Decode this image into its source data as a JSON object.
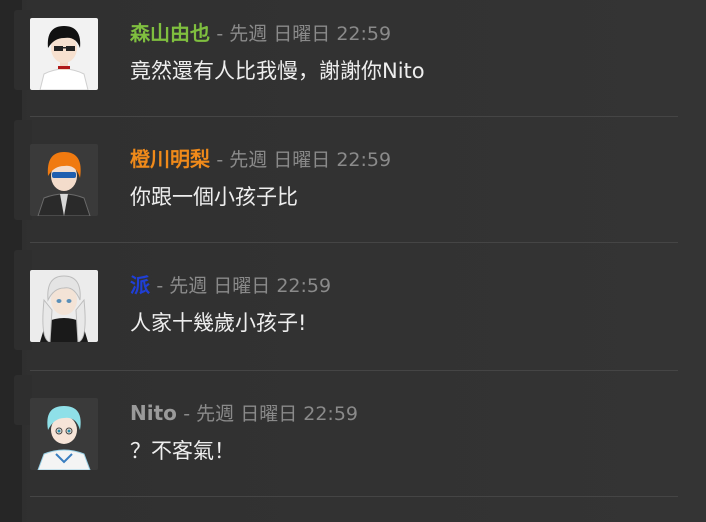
{
  "messages": [
    {
      "author": "森山由也",
      "author_color": "#7fbf3f",
      "timestamp": "- 先週 日曜日 22:59",
      "text": "竟然還有人比我慢，謝謝你Nito"
    },
    {
      "author": "橙川明梨",
      "author_color": "#f08a1a",
      "timestamp": "- 先週 日曜日 22:59",
      "text": "你跟一個小孩子比"
    },
    {
      "author": "派",
      "author_color": "#1f3fd6",
      "timestamp": "- 先週 日曜日 22:59",
      "text": "人家十幾歲小孩子!"
    },
    {
      "author": "Nito",
      "author_color": "#9a9a9a",
      "timestamp": "- 先週 日曜日 22:59",
      "text": "？不客氣！"
    }
  ]
}
